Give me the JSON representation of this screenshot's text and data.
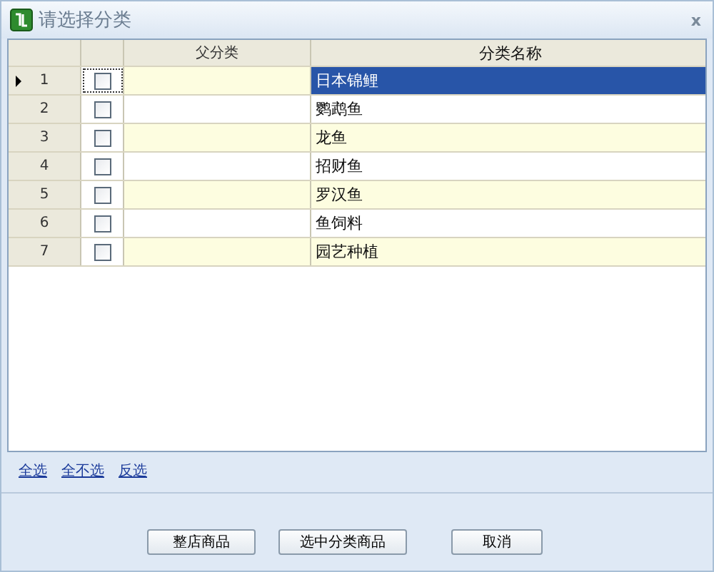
{
  "window": {
    "title": "请选择分类",
    "close": "x"
  },
  "table": {
    "columns": [
      "父分类",
      "分类名称"
    ],
    "rows": [
      {
        "number": "1",
        "checked": false,
        "parent": "",
        "name": "日本锦鲤",
        "selected": true
      },
      {
        "number": "2",
        "checked": false,
        "parent": "",
        "name": "鹦鹉鱼",
        "selected": false
      },
      {
        "number": "3",
        "checked": false,
        "parent": "",
        "name": "龙鱼",
        "selected": false
      },
      {
        "number": "4",
        "checked": false,
        "parent": "",
        "name": "招财鱼",
        "selected": false
      },
      {
        "number": "5",
        "checked": false,
        "parent": "",
        "name": "罗汉鱼",
        "selected": false
      },
      {
        "number": "6",
        "checked": false,
        "parent": "",
        "name": "鱼饲料",
        "selected": false
      },
      {
        "number": "7",
        "checked": false,
        "parent": "",
        "name": "园艺种植",
        "selected": false
      }
    ]
  },
  "links": [
    "全选",
    "全不选",
    "反选"
  ],
  "buttons": [
    "整店商品",
    "选中分类商品",
    "取消"
  ]
}
